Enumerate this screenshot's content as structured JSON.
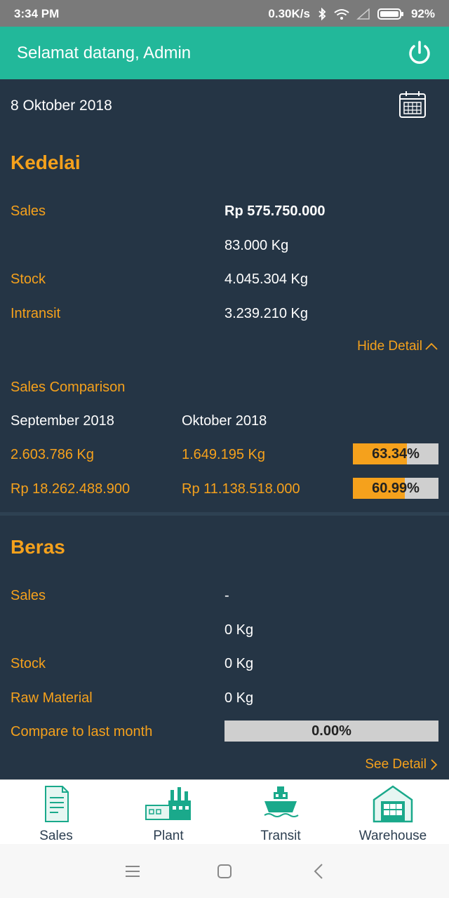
{
  "status_bar": {
    "time": "3:34 PM",
    "speed": "0.30K/s",
    "battery": "92%"
  },
  "header": {
    "greeting": "Selamat datang, Admin"
  },
  "date": "8 Oktober 2018",
  "kedelai": {
    "title": "Kedelai",
    "sales_label": "Sales",
    "sales_rp": "Rp 575.750.000",
    "sales_kg": "83.000 Kg",
    "stock_label": "Stock",
    "stock_value": "4.045.304 Kg",
    "intransit_label": "Intransit",
    "intransit_value": "3.239.210 Kg",
    "hide_detail": "Hide Detail",
    "comparison_title": "Sales Comparison",
    "prev_month": "September 2018",
    "curr_month": "Oktober 2018",
    "rows": [
      {
        "prev": "2.603.786 Kg",
        "curr": "1.649.195 Kg",
        "pct": "63.34%",
        "fill": 0.6334
      },
      {
        "prev": "Rp 18.262.488.900",
        "curr": "Rp 11.138.518.000",
        "pct": "60.99%",
        "fill": 0.6099
      }
    ]
  },
  "beras": {
    "title": "Beras",
    "sales_label": "Sales",
    "sales_value": "-",
    "sales_kg": "0 Kg",
    "stock_label": "Stock",
    "stock_value": "0 Kg",
    "raw_label": "Raw Material",
    "raw_value": "0 Kg",
    "compare_label": "Compare to last month",
    "compare_pct": "0.00%",
    "compare_fill": 0,
    "see_detail": "See Detail"
  },
  "bottom_nav": [
    "Sales",
    "Plant",
    "Transit",
    "Warehouse"
  ],
  "colors": {
    "accent": "#f5a11c",
    "header": "#22b89a",
    "background": "#253545"
  }
}
